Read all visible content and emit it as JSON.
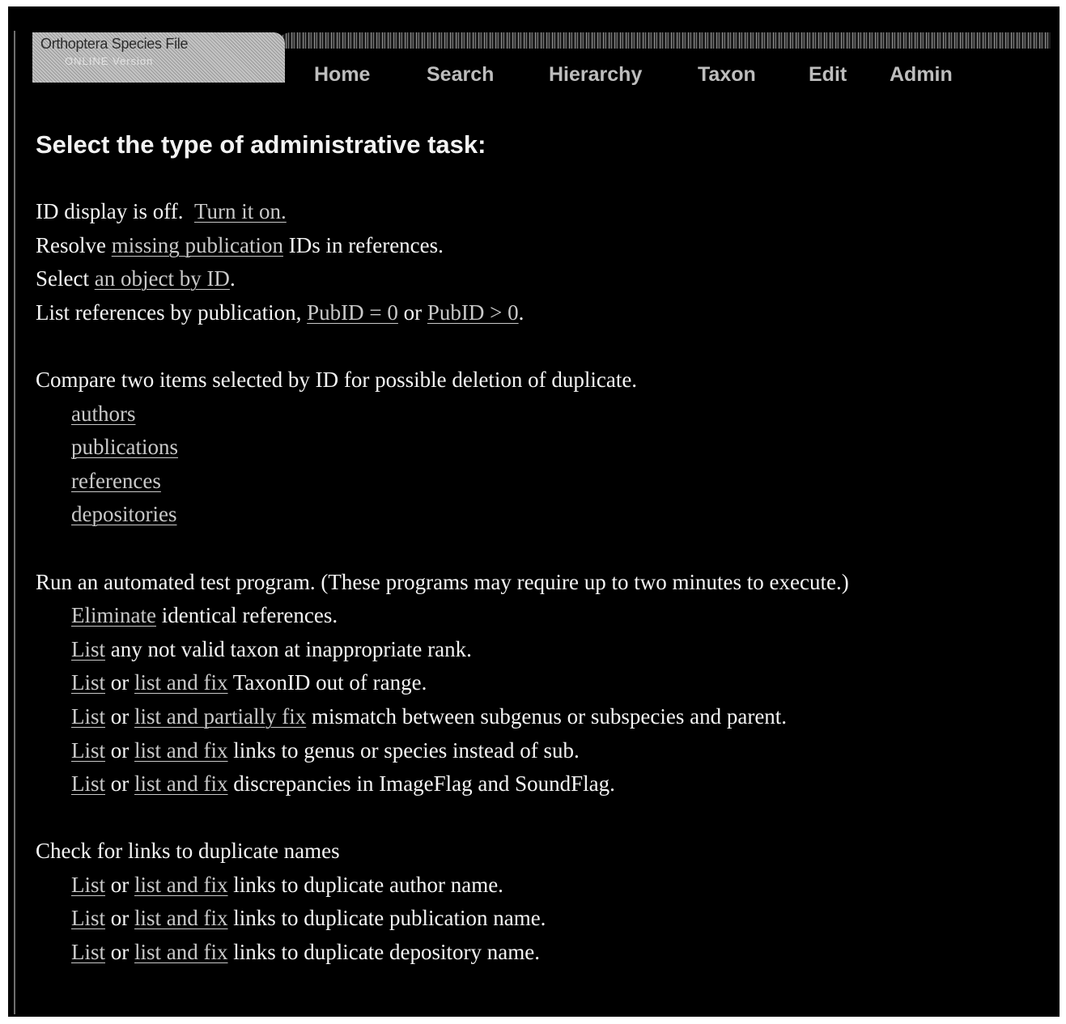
{
  "header": {
    "logo_title": "Orthoptera Species File",
    "logo_subtitle": "ONLINE Version"
  },
  "nav": {
    "home": "Home",
    "search": "Search",
    "hierarchy": "Hierarchy",
    "taxon": "Taxon",
    "edit": "Edit",
    "admin": "Admin"
  },
  "heading": "Select the type of administrative task:",
  "id_section": {
    "id_display_text": "ID display is off.",
    "turn_on_link": "Turn it on.",
    "resolve_pre": "Resolve",
    "missing_publication_link": "missing publication",
    "resolve_post": "IDs in references.",
    "select_pre": "Select",
    "object_by_id_link": "an object by ID",
    "select_post": ".",
    "list_refs_pre": "List references by publication,",
    "pubid_zero_link": "PubID = 0",
    "or_word": "or",
    "pubid_gt_zero_link": "PubID > 0",
    "list_refs_post": "."
  },
  "compare_section": {
    "intro": "Compare two items selected by ID for possible deletion of duplicate.",
    "links": {
      "authors": "authors",
      "publications": "publications",
      "references": "references",
      "depositories": "depositories"
    }
  },
  "tests_section": {
    "intro": "Run an automated test program.  (These programs may require up to two minutes to execute.)",
    "eliminate_link": "Eliminate",
    "eliminate_text": "identical references.",
    "list_link": "List",
    "or_word": "or",
    "list_and_fix_link": "list and fix",
    "list_and_partially_fix_link": "list and partially fix",
    "item_invalid_rank_text": "any not valid taxon at inappropriate rank.",
    "item_taxonid_text": "TaxonID out of range.",
    "item_mismatch_text": "mismatch between subgenus or subspecies and parent.",
    "item_links_sub_text": "links to genus or species instead of sub.",
    "item_flags_text": "discrepancies in ImageFlag and SoundFlag."
  },
  "duplicates_section": {
    "intro": "Check for links to duplicate names",
    "list_link": "List",
    "or_word": "or",
    "list_and_fix_link": "list and fix",
    "author_text": "links to duplicate author name.",
    "publication_text": "links to duplicate publication name.",
    "depository_text": "links to duplicate depository name."
  }
}
